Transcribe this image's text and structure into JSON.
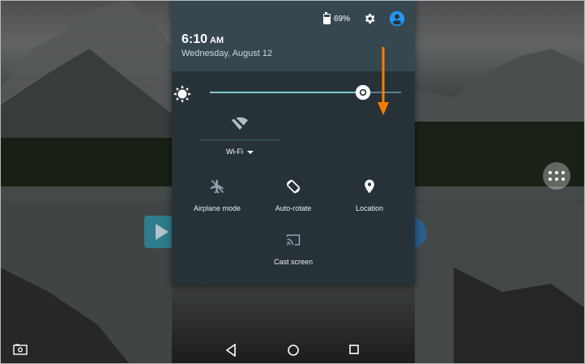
{
  "status": {
    "battery_text": "69%",
    "battery_level": 0.69
  },
  "clock": {
    "time": "6:10",
    "ampm": "AM",
    "date": "Wednesday, August 12"
  },
  "brightness": {
    "level": 0.8
  },
  "tiles": {
    "wifi": {
      "label": "Wi-Fi"
    },
    "airplane": {
      "label": "Airplane mode"
    },
    "autorotate": {
      "label": "Auto-rotate"
    },
    "location": {
      "label": "Location"
    },
    "cast": {
      "label": "Cast screen"
    }
  },
  "colors": {
    "shade_bg": "#263238",
    "header_bg": "#37474f",
    "accent": "#80cbc4",
    "avatar": "#2196f3",
    "arrow": "#f57c00"
  },
  "icons": [
    "battery-icon",
    "gear-icon",
    "account-icon",
    "brightness-icon",
    "wifi-off-icon",
    "airplane-icon",
    "rotate-icon",
    "location-pin-icon",
    "cast-icon",
    "screenshot-icon",
    "back-icon",
    "home-icon",
    "recents-icon",
    "app-drawer-icon"
  ]
}
